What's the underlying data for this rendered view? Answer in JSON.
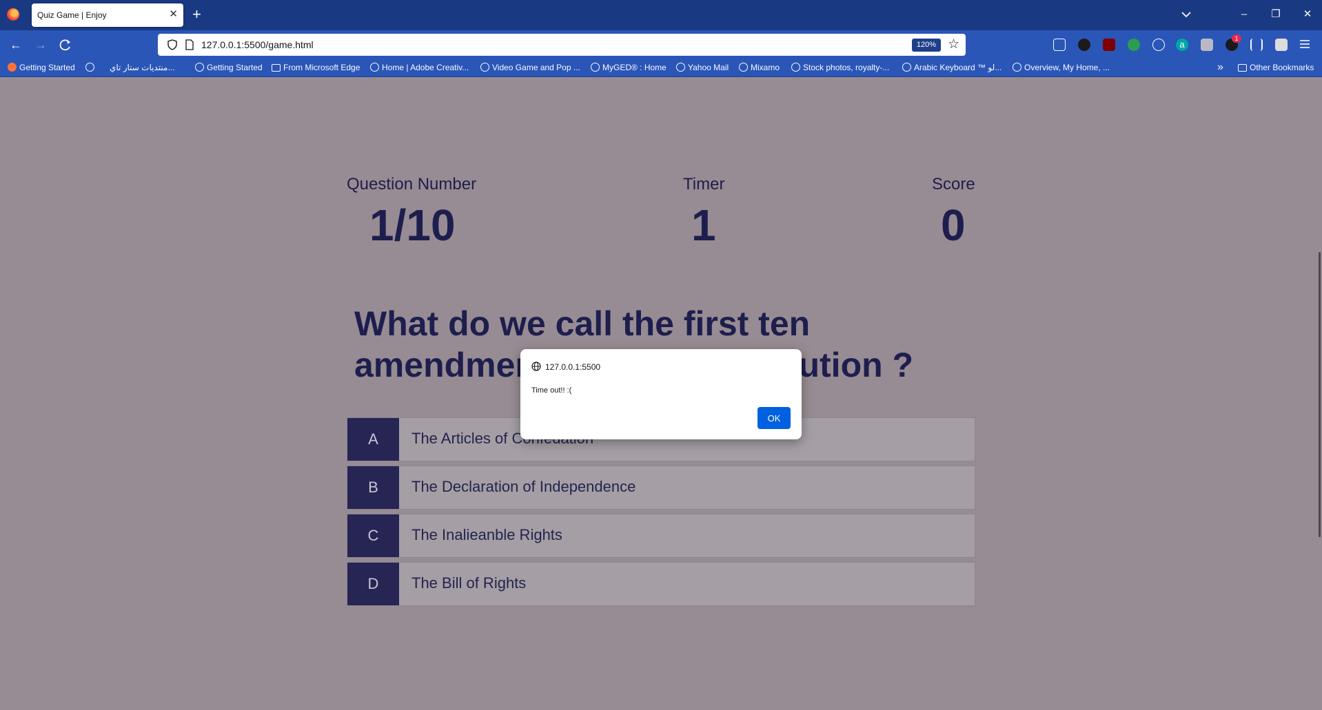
{
  "browser": {
    "tab_title": "Quiz Game | Enjoy",
    "url": "127.0.0.1:5500/game.html",
    "zoom": "120%",
    "bookmarks": [
      {
        "label": "Getting Started",
        "icon": "firefox-icon"
      },
      {
        "label": "",
        "icon": "globe-icon"
      },
      {
        "label": "منتديات ستار تاي...",
        "icon": ""
      },
      {
        "label": "Getting Started",
        "icon": "globe-icon"
      },
      {
        "label": "From Microsoft Edge",
        "icon": "folder-icon"
      },
      {
        "label": "Home | Adobe Creativ...",
        "icon": "globe-icon"
      },
      {
        "label": "Video Game and Pop ...",
        "icon": "globe-icon"
      },
      {
        "label": "MyGED® : Home",
        "icon": "globe-icon"
      },
      {
        "label": "Yahoo Mail",
        "icon": "globe-icon"
      },
      {
        "label": "Mixamo",
        "icon": "globe-icon"
      },
      {
        "label": "Stock photos, royalty-...",
        "icon": "globe-icon"
      },
      {
        "label": "Arabic Keyboard ™ لو...",
        "icon": "globe-icon"
      },
      {
        "label": "Overview, My Home, ...",
        "icon": "globe-icon"
      }
    ],
    "other_bookmarks": "Other Bookmarks",
    "extension_badge": "1"
  },
  "game": {
    "question_number_label": "Question Number",
    "question_number_value": "1/10",
    "timer_label": "Timer",
    "timer_value": "1",
    "score_label": "Score",
    "score_value": "0",
    "question": "What do we call the first ten amendments to the Constitution ?",
    "choices": [
      {
        "prefix": "A",
        "text": "The Articles of Confedation"
      },
      {
        "prefix": "B",
        "text": "The Declaration of Independence"
      },
      {
        "prefix": "C",
        "text": "The Inalieanble Rights"
      },
      {
        "prefix": "D",
        "text": "The Bill of Rights"
      }
    ]
  },
  "dialog": {
    "origin": "127.0.0.1:5500",
    "message": "Time out!! :(",
    "ok_label": "OK"
  },
  "colors": {
    "tabbar": "#193a82",
    "navbar": "#2a56b8",
    "page_bg": "#978c93",
    "prefix_bg": "#262553",
    "text_dark": "#1e1e4e",
    "ok_button": "#0061e0"
  }
}
